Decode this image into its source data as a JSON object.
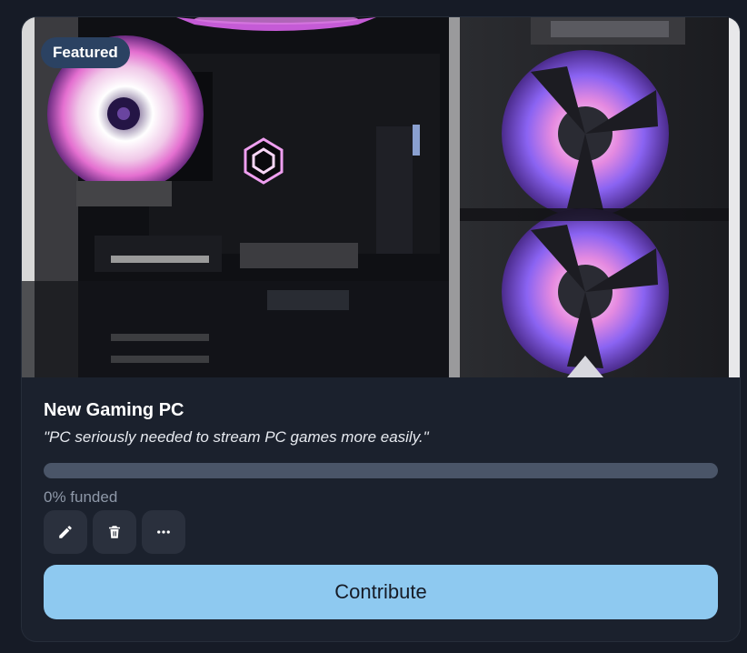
{
  "card": {
    "badge": "Featured",
    "title": "New Gaming PC",
    "description": "\"PC seriously needed to stream PC games more easily.\"",
    "funded_percent": 0,
    "funded_label": "0% funded",
    "contribute_label": "Contribute",
    "image_subject": "gaming-pc-interior-rgb-fans"
  },
  "actions": [
    {
      "name": "edit",
      "icon": "pencil-icon"
    },
    {
      "name": "delete",
      "icon": "trash-icon"
    },
    {
      "name": "more",
      "icon": "ellipsis-icon"
    }
  ],
  "colors": {
    "page_bg": "#161b26",
    "card_bg": "#1b212d",
    "badge_bg": "#2b4262",
    "progress_track": "#4a5568",
    "accent": "#8ec9f0"
  }
}
